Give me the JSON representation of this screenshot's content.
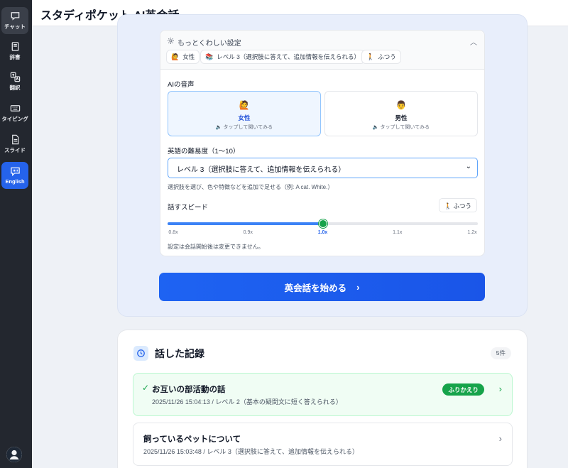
{
  "app": {
    "title": "スタディポケット AI英会話"
  },
  "sidebar": {
    "items": [
      {
        "label": "チャット",
        "icon": "chat-icon"
      },
      {
        "label": "辞書",
        "icon": "book-icon"
      },
      {
        "label": "翻訳",
        "icon": "translate-icon"
      },
      {
        "label": "タイピング",
        "icon": "keyboard-icon"
      },
      {
        "label": "スライド",
        "icon": "document-icon"
      },
      {
        "label": "English",
        "icon": "english-chat-icon",
        "active": true
      }
    ]
  },
  "settings": {
    "title": "もっとくわしい設定",
    "chips": [
      {
        "emoji": "🙋",
        "label": "女性"
      },
      {
        "emoji": "📚",
        "label": "レベル 3（選択肢に答えて、追加情報を伝えられる）"
      },
      {
        "emoji": "🚶",
        "label": "ふつう"
      }
    ],
    "voice_label": "AIの音声",
    "voices": [
      {
        "face": "🙋",
        "name": "女性",
        "hint": "🔈 タップして聞いてみる",
        "selected": true
      },
      {
        "face": "👨",
        "name": "男性",
        "hint": "🔈 タップして聞いてみる",
        "selected": false
      }
    ],
    "difficulty_label": "英語の難易度（1〜10）",
    "difficulty_value": "レベル 3（選択肢に答えて、追加情報を伝えられる）",
    "difficulty_hint": "選択肢を選び、色や特徴などを追加で足せる（例: A cat. White.）",
    "speed_label": "話すスピード",
    "speed_value_label": "🚶 ふつう",
    "speed_ticks": [
      "0.8x",
      "0.9x",
      "1.0x",
      "1.1x",
      "1.2x"
    ],
    "speed_selected_index": 2,
    "lock_note": "設定は会話開始後は変更できません。"
  },
  "start_button": {
    "label": "英会話を始める",
    "arrow": "›"
  },
  "history": {
    "title": "話した記録",
    "count": "5件",
    "records": [
      {
        "title": "お互いの部活動の話",
        "sub": "2025/11/26 15:04:13 / レベル 2（基本の疑問文に短く答えられる）",
        "done": true,
        "review_label": "ふりかえり",
        "check": "✓",
        "arrow": "›"
      },
      {
        "title": "飼っているペットについて",
        "sub": "2025/11/26 15:03:48 / レベル 3（選択肢に答えて、追加情報を伝えられる）",
        "done": false,
        "arrow": "›"
      }
    ]
  },
  "colors": {
    "accent": "#1d5cf0",
    "sidebar_bg": "#23272f",
    "success": "#16a34a"
  }
}
